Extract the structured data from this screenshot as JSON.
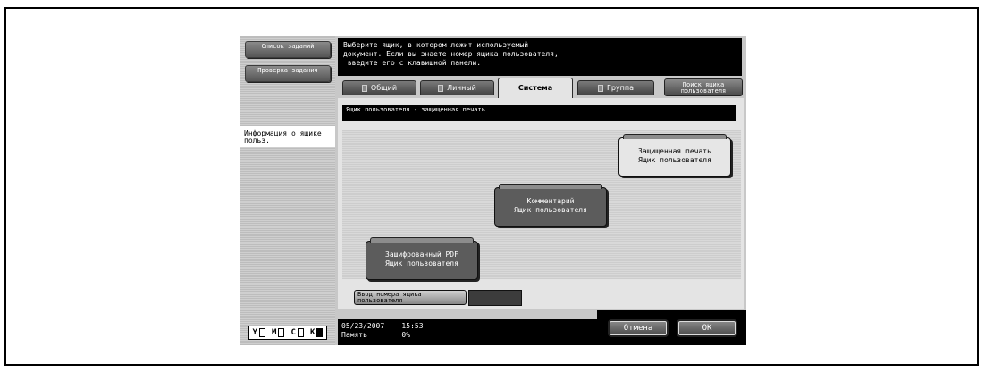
{
  "left_panel": {
    "job_list_button": "Список заданий",
    "job_check_button": "Проверка задания",
    "info_label": "Информация о ящике польз."
  },
  "toner": [
    "Y",
    "M",
    "C",
    "K"
  ],
  "message": {
    "line1": "Выберите ящик, в котором лежит используемый",
    "line2": "документ. Если вы знаете номер ящика пользователя,",
    "line3": " введите его с клавишной панели."
  },
  "tabs": [
    {
      "label": "Общий"
    },
    {
      "label": "Личный"
    },
    {
      "label": "Система",
      "active": true
    },
    {
      "label": "Группа"
    }
  ],
  "search_button": "Поиск ящика пользователя",
  "path_label": "Ящик пользователя - защищенная печать",
  "boxes": {
    "secure_print": {
      "line1": "Защищенная печать",
      "line2": "Ящик пользователя"
    },
    "comment": {
      "line1": "Комментарий",
      "line2": "Ящик пользователя"
    },
    "encrypted_pdf": {
      "line1": "Зашифрованный PDF",
      "line2": "Ящик пользователя"
    }
  },
  "entry_button": "Ввод номера ящика пользователя",
  "status": {
    "date_time": "05/23/2007    15:53",
    "memory": "Память        0%"
  },
  "cancel_button": "Отмена",
  "ok_button": "OK"
}
